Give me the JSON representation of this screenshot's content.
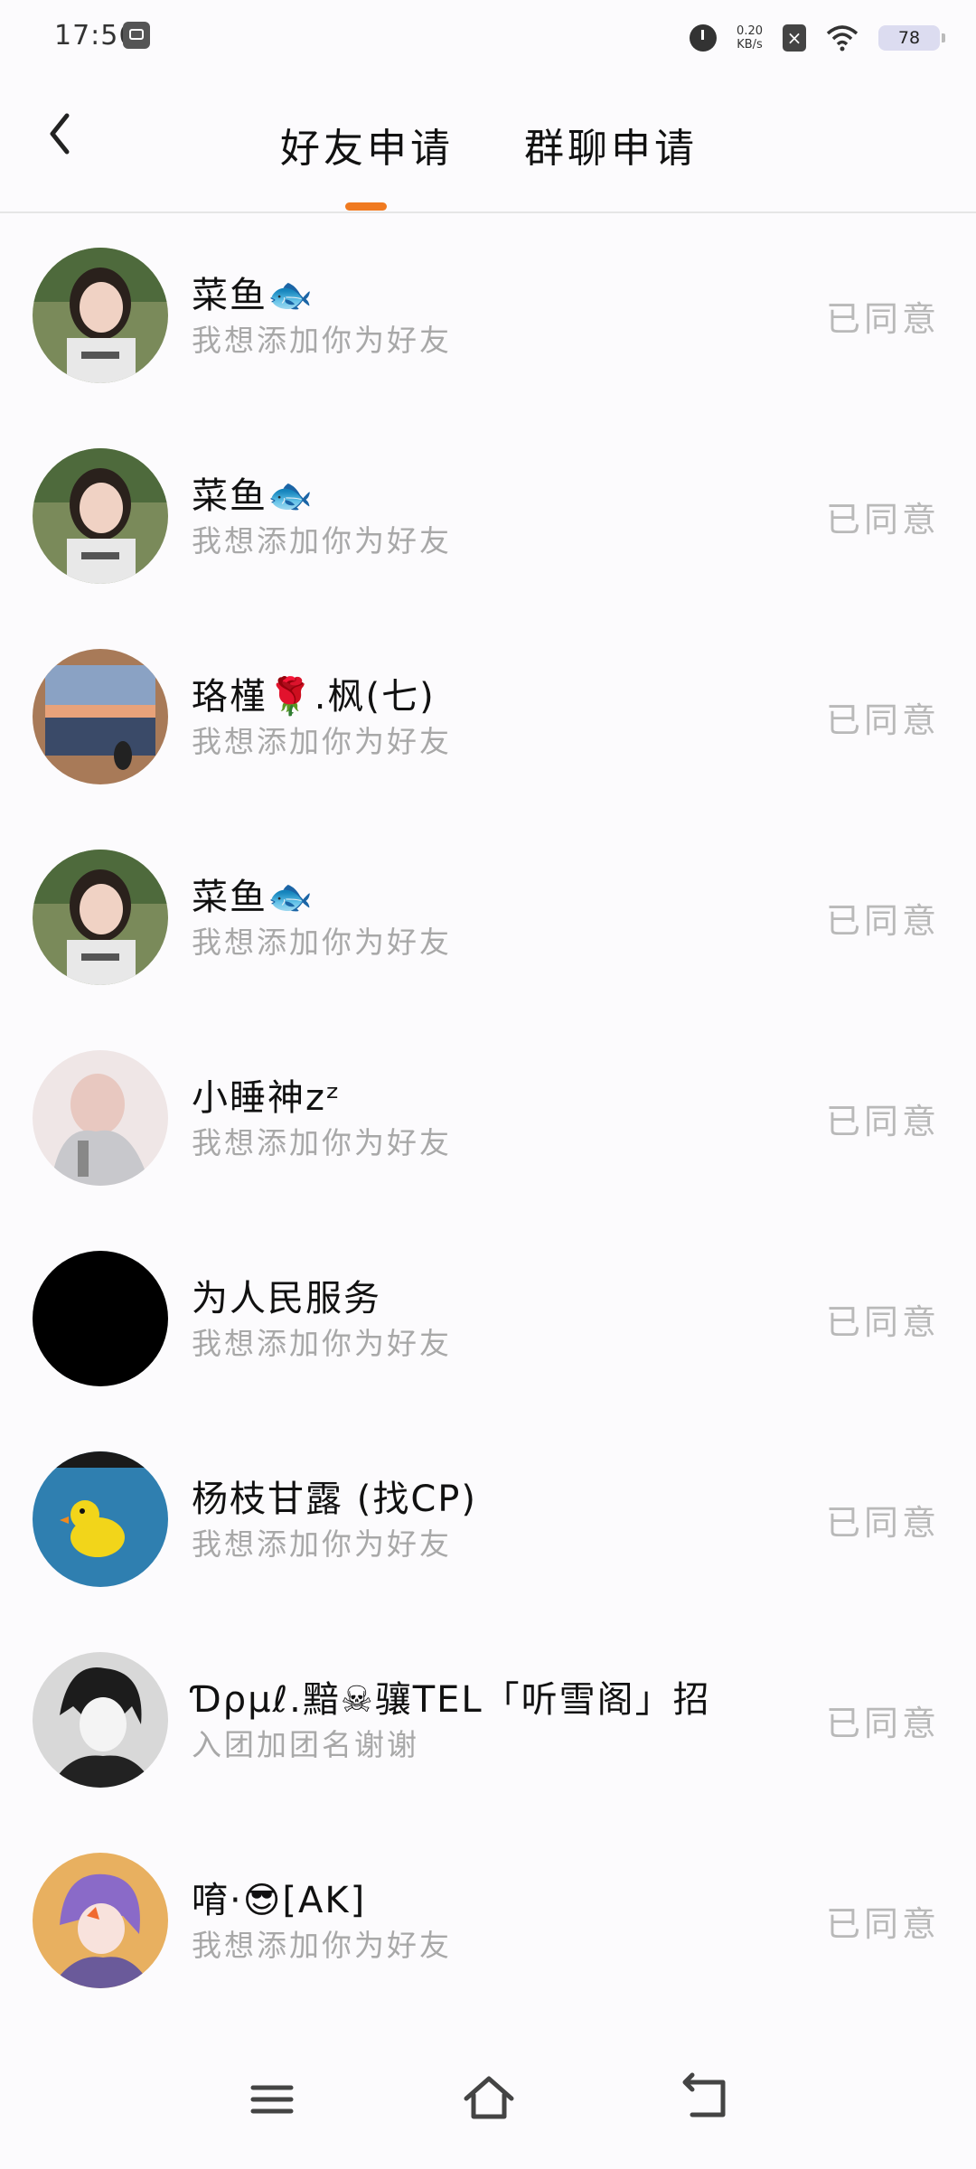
{
  "status_bar": {
    "time": "17:56",
    "net_speed_value": "0.20",
    "net_speed_unit": "KB/s",
    "battery": "78"
  },
  "header": {
    "tabs": [
      {
        "label": "好友申请",
        "active": true
      },
      {
        "label": "群聊申请",
        "active": false
      }
    ],
    "accent_color": "#f07a20"
  },
  "requests": [
    {
      "name": "菜鱼🐟",
      "message": "我想添加你为好友",
      "status": "已同意",
      "avatar": "girl-photo"
    },
    {
      "name": "菜鱼🐟",
      "message": "我想添加你为好友",
      "status": "已同意",
      "avatar": "girl-photo"
    },
    {
      "name": "珞槿🌹.枫(七)",
      "message": "我想添加你为好友",
      "status": "已同意",
      "avatar": "sunset-window"
    },
    {
      "name": "菜鱼🐟",
      "message": "我想添加你为好友",
      "status": "已同意",
      "avatar": "girl-photo"
    },
    {
      "name": "小睡神zᶻ",
      "message": "我想添加你为好友",
      "status": "已同意",
      "avatar": "hands-hoodie"
    },
    {
      "name": "为人民服务",
      "message": "我想添加你为好友",
      "status": "已同意",
      "avatar": "black-circle"
    },
    {
      "name": "杨枝甘露 (找CP)",
      "message": "我想添加你为好友",
      "status": "已同意",
      "avatar": "yellow-duck"
    },
    {
      "name": "Ɗρμℓ.黯☠骧TEL「听雪阁」招",
      "message": "入团加团名谢谢",
      "status": "已同意",
      "avatar": "anime-boy"
    },
    {
      "name": "唷·😎[AK]",
      "message": "我想添加你为好友",
      "status": "已同意",
      "avatar": "anime-girl"
    }
  ]
}
